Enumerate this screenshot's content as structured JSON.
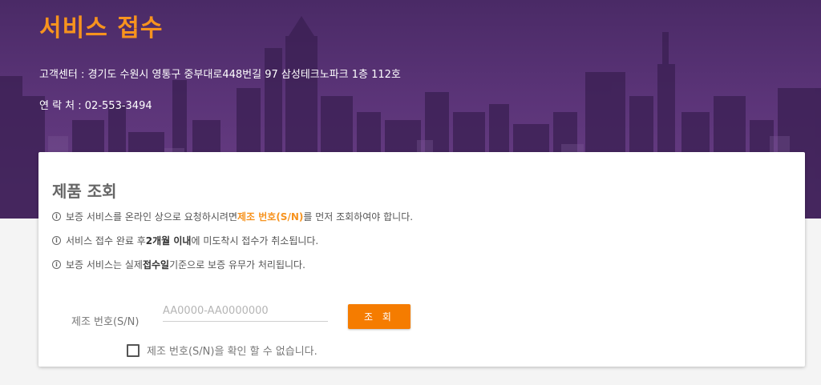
{
  "hero": {
    "title": "서비스 접수",
    "address": "고객센터 : 경기도 수원시 영통구 중부대로448번길 97 삼성테크노파크 1층 112호",
    "phone": "연 락 처 : 02-553-3494"
  },
  "card": {
    "title": "제품 조회",
    "notices": [
      {
        "pre": "보증 서비스를 온라인 상으로 요청하시려면 ",
        "highlight": "제조 번호(S/N)",
        "post": "를 먼저 조회하여야 합니다."
      },
      {
        "pre": "서비스 접수 완료 후 ",
        "bold": "2개월 이내",
        "post": "에 미도착시 접수가 취소됩니다."
      },
      {
        "pre": "보증 서비스는 실제 ",
        "bold": "접수일",
        "post": " 기준으로 보증 유무가 처리됩니다."
      }
    ],
    "info_icon": "i",
    "serial_label": "제조 번호(S/N)",
    "serial_placeholder": "AA0000-AA0000000",
    "serial_value": "",
    "search_button": "조 회",
    "unknown_checkbox_label": "제조 번호(S/N)을 확인 할 수 없습니다.",
    "unknown_checked": false
  },
  "colors": {
    "accent": "#f57c00",
    "title_orange": "#f7931e",
    "hero_purple": "#5b3478"
  }
}
